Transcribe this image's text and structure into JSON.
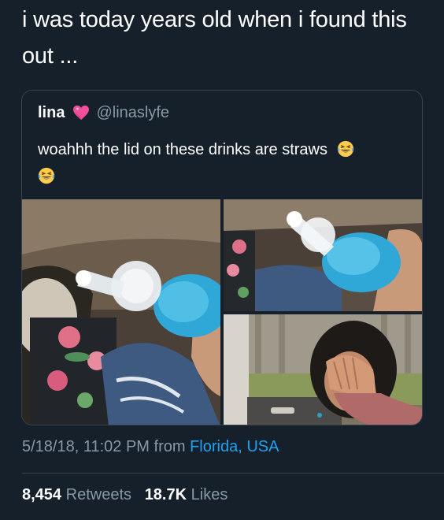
{
  "tweet": {
    "text": "i was today years old when i found this out ..."
  },
  "quote": {
    "name": "lina",
    "heart_icon": "pink-heart-emoji",
    "handle": "@linaslyfe",
    "text": "woahhh the lid on these drinks are straws",
    "emoji_icon": "tears-of-joy-emoji"
  },
  "media": {
    "photos": [
      {
        "subject": "blue drink bottle with straw lid, held in car"
      },
      {
        "subject": "close-up of straw lid on blue drink bottle"
      },
      {
        "subject": "person covering face with hand"
      }
    ]
  },
  "meta": {
    "timestamp": "5/18/18, 11:02 PM from",
    "location": "Florida, USA"
  },
  "stats": {
    "retweets_count": "8,454",
    "retweets_label": "Retweets",
    "likes_count": "18.7K",
    "likes_label": "Likes"
  },
  "colors": {
    "background": "#15202b",
    "secondary_text": "#8899a6",
    "link": "#1da1f2",
    "border": "#38444d"
  }
}
